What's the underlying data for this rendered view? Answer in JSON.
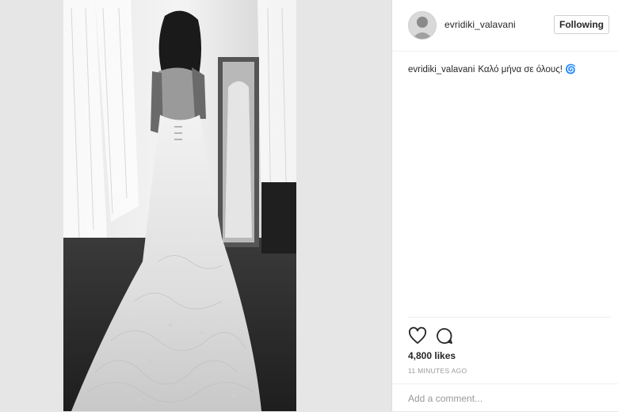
{
  "post": {
    "username": "evridiki_valavani",
    "follow_label": "Following",
    "caption_user": "evridiki_valavani",
    "caption_text": "Καλό μήνα σε όλους!",
    "caption_emoji": "🌀",
    "likes": "4,800 likes",
    "timestamp": "11 MINUTES AGO",
    "comment_placeholder": "Add a comment..."
  },
  "icons": {
    "like": "heart-outline-icon",
    "comment": "speech-bubble-icon"
  },
  "colors": {
    "text": "#262626",
    "muted": "#999999",
    "border": "#efefef",
    "page_background": "#e6e6e6"
  }
}
